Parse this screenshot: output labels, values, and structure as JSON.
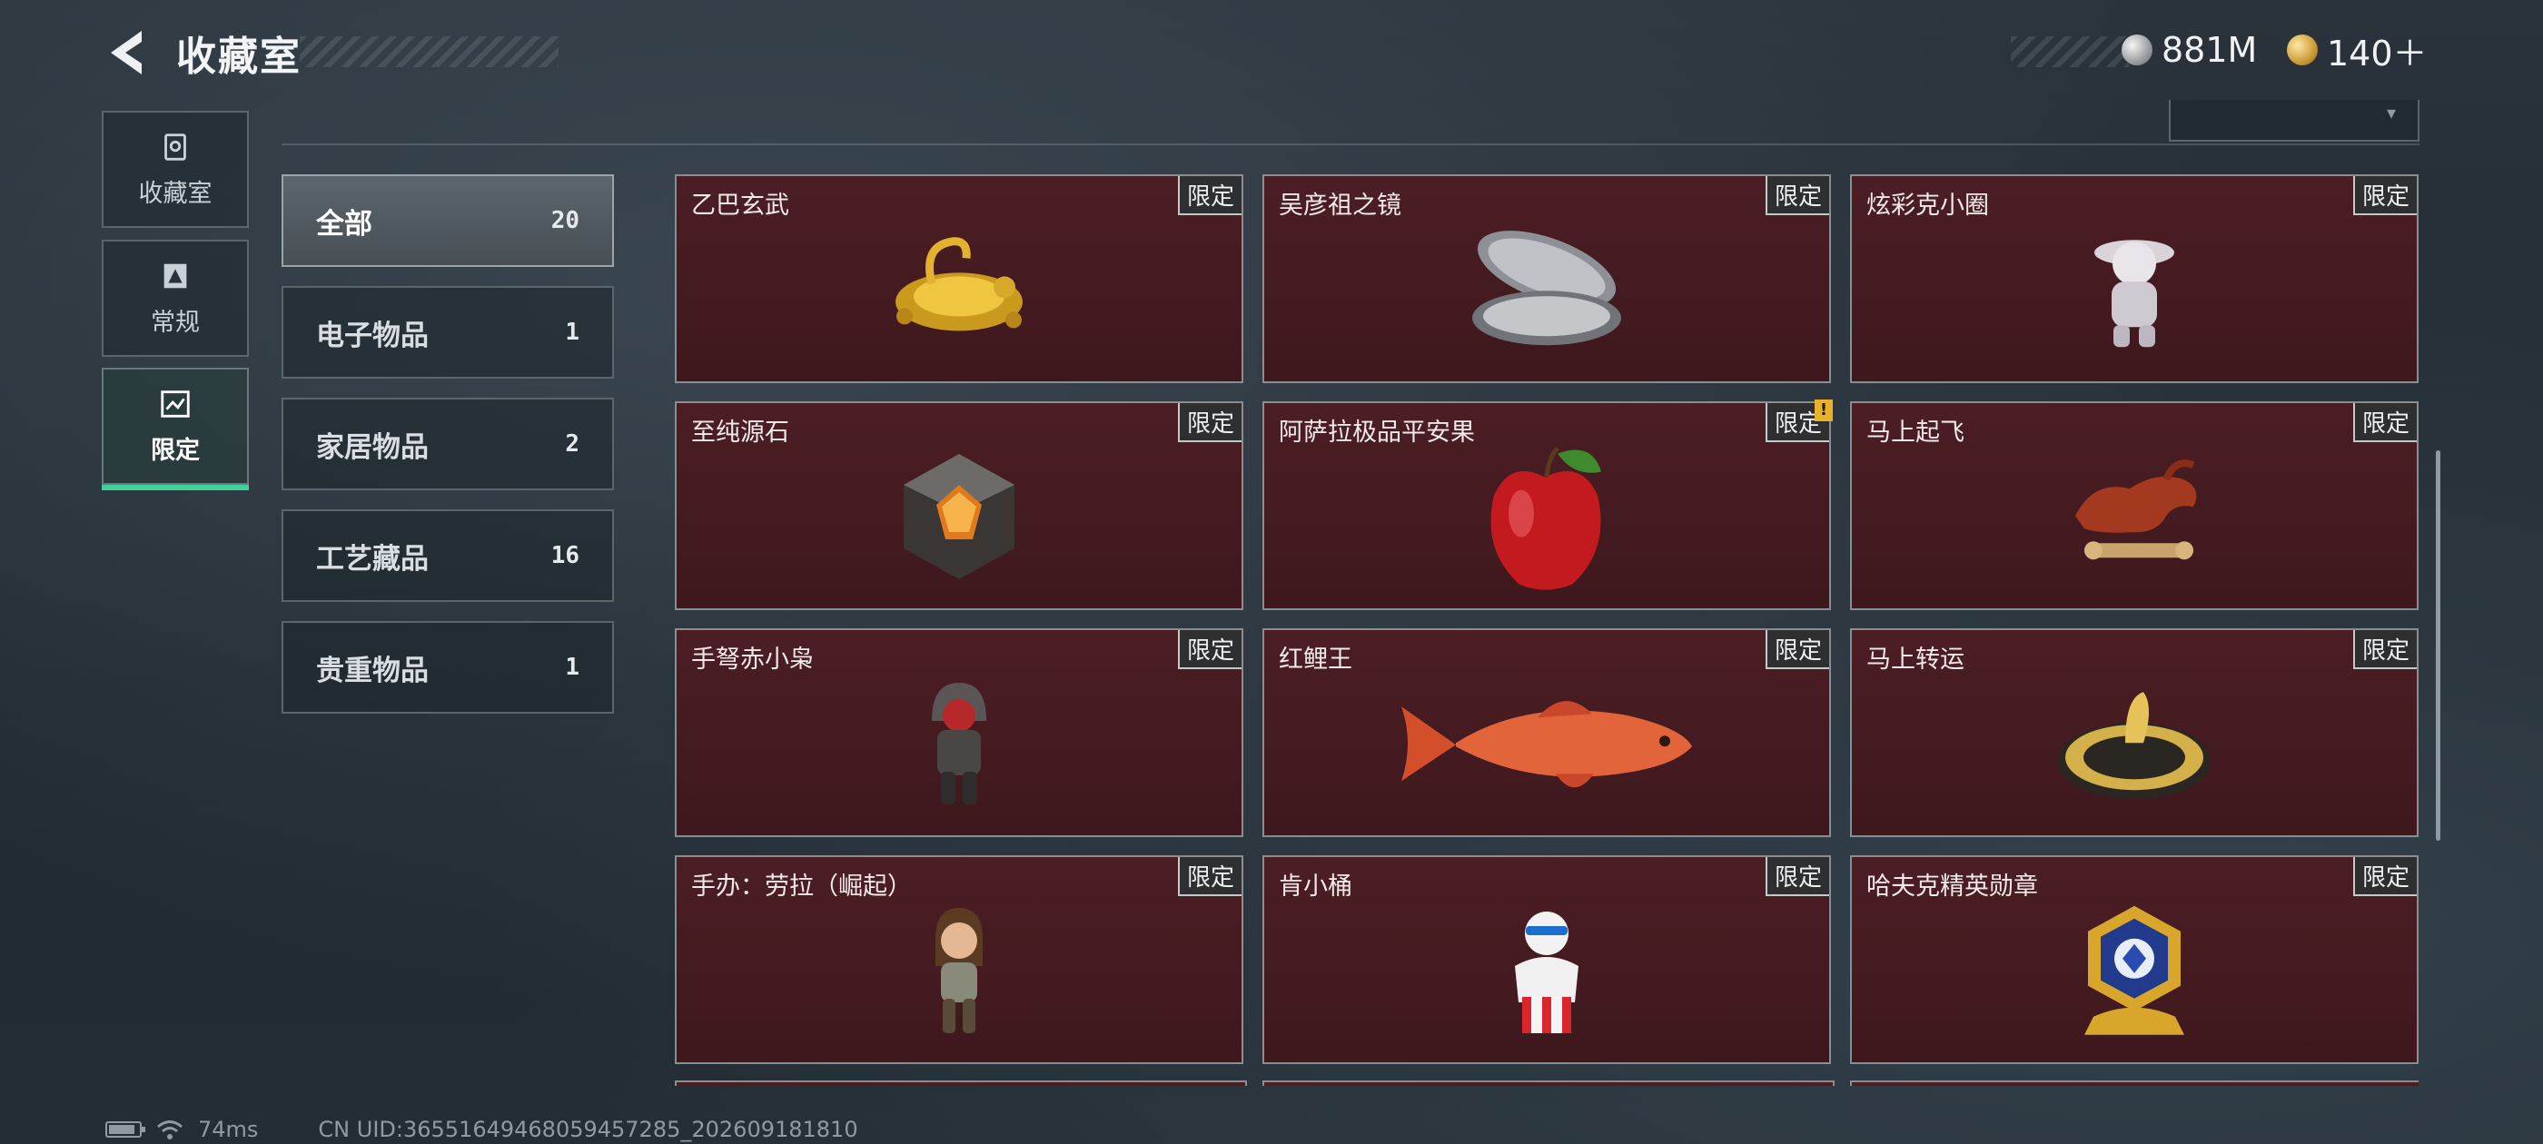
{
  "header": {
    "title": "收藏室"
  },
  "currencies": [
    {
      "icon": "silver-coin-icon",
      "value": "881M"
    },
    {
      "icon": "gold-coin-icon",
      "value": "140＋"
    }
  ],
  "nav": [
    {
      "label": "收藏室",
      "icon": "collection-room-icon",
      "active": false
    },
    {
      "label": "常规",
      "icon": "regular-icon",
      "active": false
    },
    {
      "label": "限定",
      "icon": "limited-icon",
      "active": true
    }
  ],
  "categories": [
    {
      "name": "全部",
      "count": "20",
      "active": true
    },
    {
      "name": "电子物品",
      "count": "1"
    },
    {
      "name": "家居物品",
      "count": "2"
    },
    {
      "name": "工艺藏品",
      "count": "16"
    },
    {
      "name": "贵重物品",
      "count": "1"
    }
  ],
  "tag_label": "限定",
  "items": [
    {
      "name": "乙巴玄武",
      "art": "golden-turtle-snake-icon"
    },
    {
      "name": "吴彦祖之镜",
      "art": "compact-mirror-icon"
    },
    {
      "name": "炫彩克小圈",
      "art": "figurine-icon"
    },
    {
      "name": "至纯源石",
      "art": "crystal-stone-icon"
    },
    {
      "name": "阿萨拉极品平安果",
      "art": "red-apple-icon",
      "alert": "!"
    },
    {
      "name": "马上起飞",
      "art": "horse-statue-icon"
    },
    {
      "name": "手弩赤小枭",
      "art": "hooded-figure-icon"
    },
    {
      "name": "红鲤王",
      "art": "red-carp-icon"
    },
    {
      "name": "马上转运",
      "art": "fortune-wheel-icon"
    },
    {
      "name": "手办：劳拉（崛起）",
      "art": "lara-figure-icon"
    },
    {
      "name": "肯小桶",
      "art": "kfc-figure-icon"
    },
    {
      "name": "哈夫克精英勋章",
      "art": "elite-medal-icon"
    }
  ],
  "status": {
    "ping": "74ms",
    "uid": "CN UID:36551649468059457285_202609181810"
  }
}
